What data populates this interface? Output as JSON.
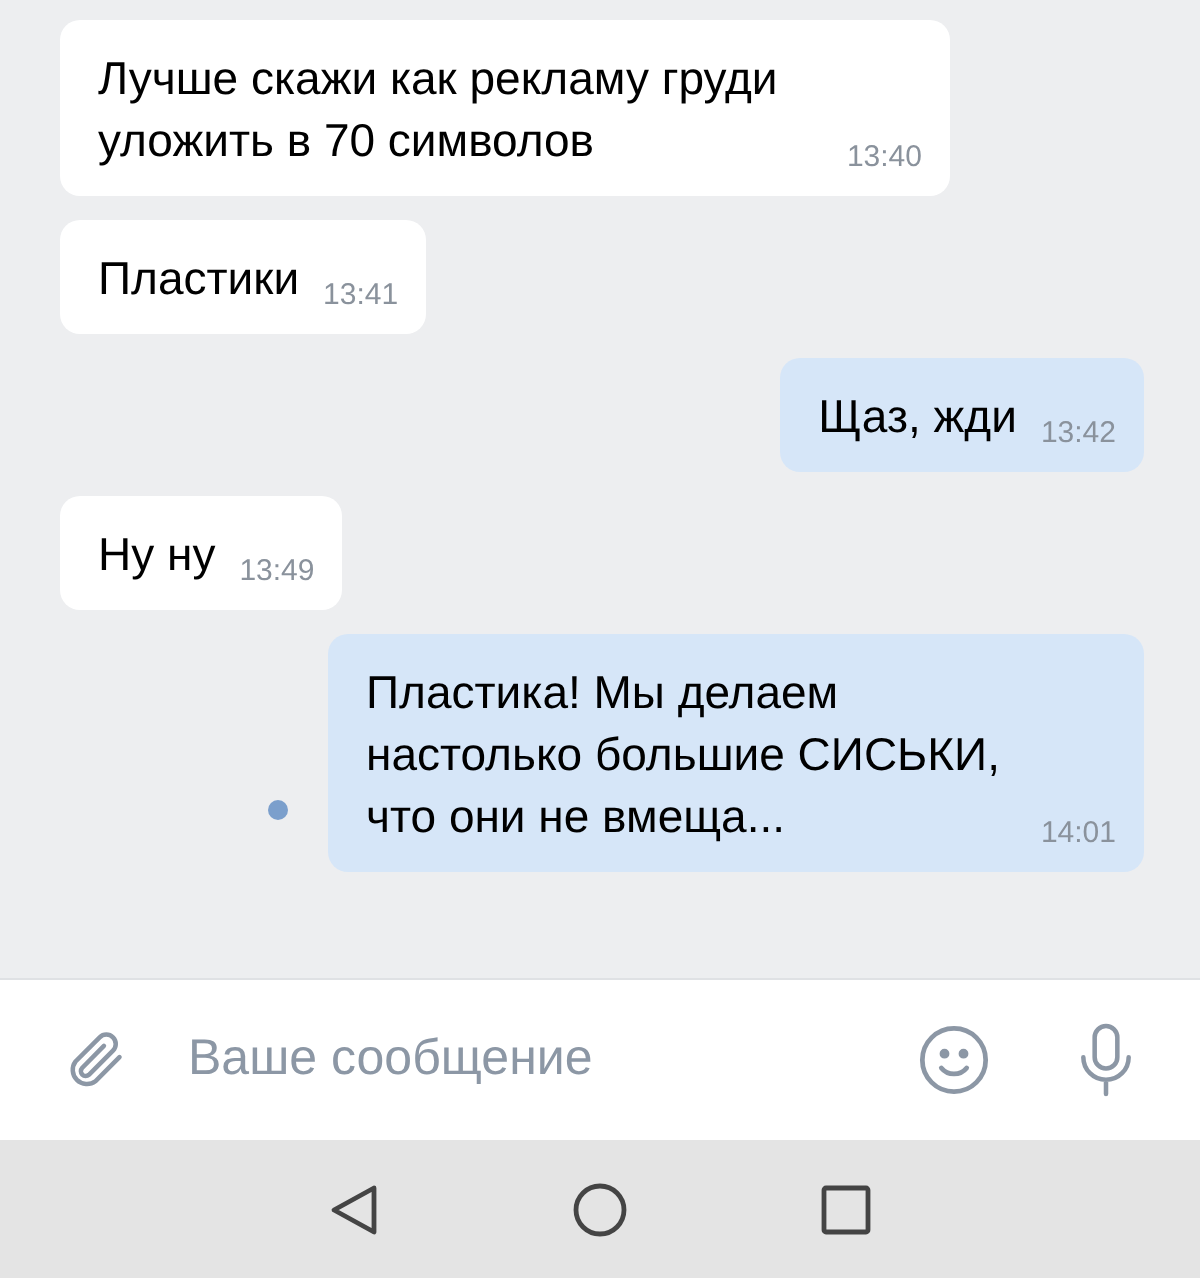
{
  "messages": [
    {
      "kind": "incoming",
      "text": "Лучше скажи как рекламу груди уложить в 70 символов",
      "time": "13:40",
      "unread": false
    },
    {
      "kind": "incoming",
      "text": "Пластики",
      "time": "13:41",
      "unread": false
    },
    {
      "kind": "outgoing",
      "text": "Щаз, жди",
      "time": "13:42",
      "unread": false
    },
    {
      "kind": "incoming",
      "text": "Ну ну",
      "time": "13:49",
      "unread": false
    },
    {
      "kind": "outgoing",
      "text": "Пластика! Мы делаем настолько большие СИСЬКИ, что они не вмеща...",
      "time": "14:01",
      "unread": true
    }
  ],
  "composer": {
    "placeholder": "Ваше сообщение"
  }
}
